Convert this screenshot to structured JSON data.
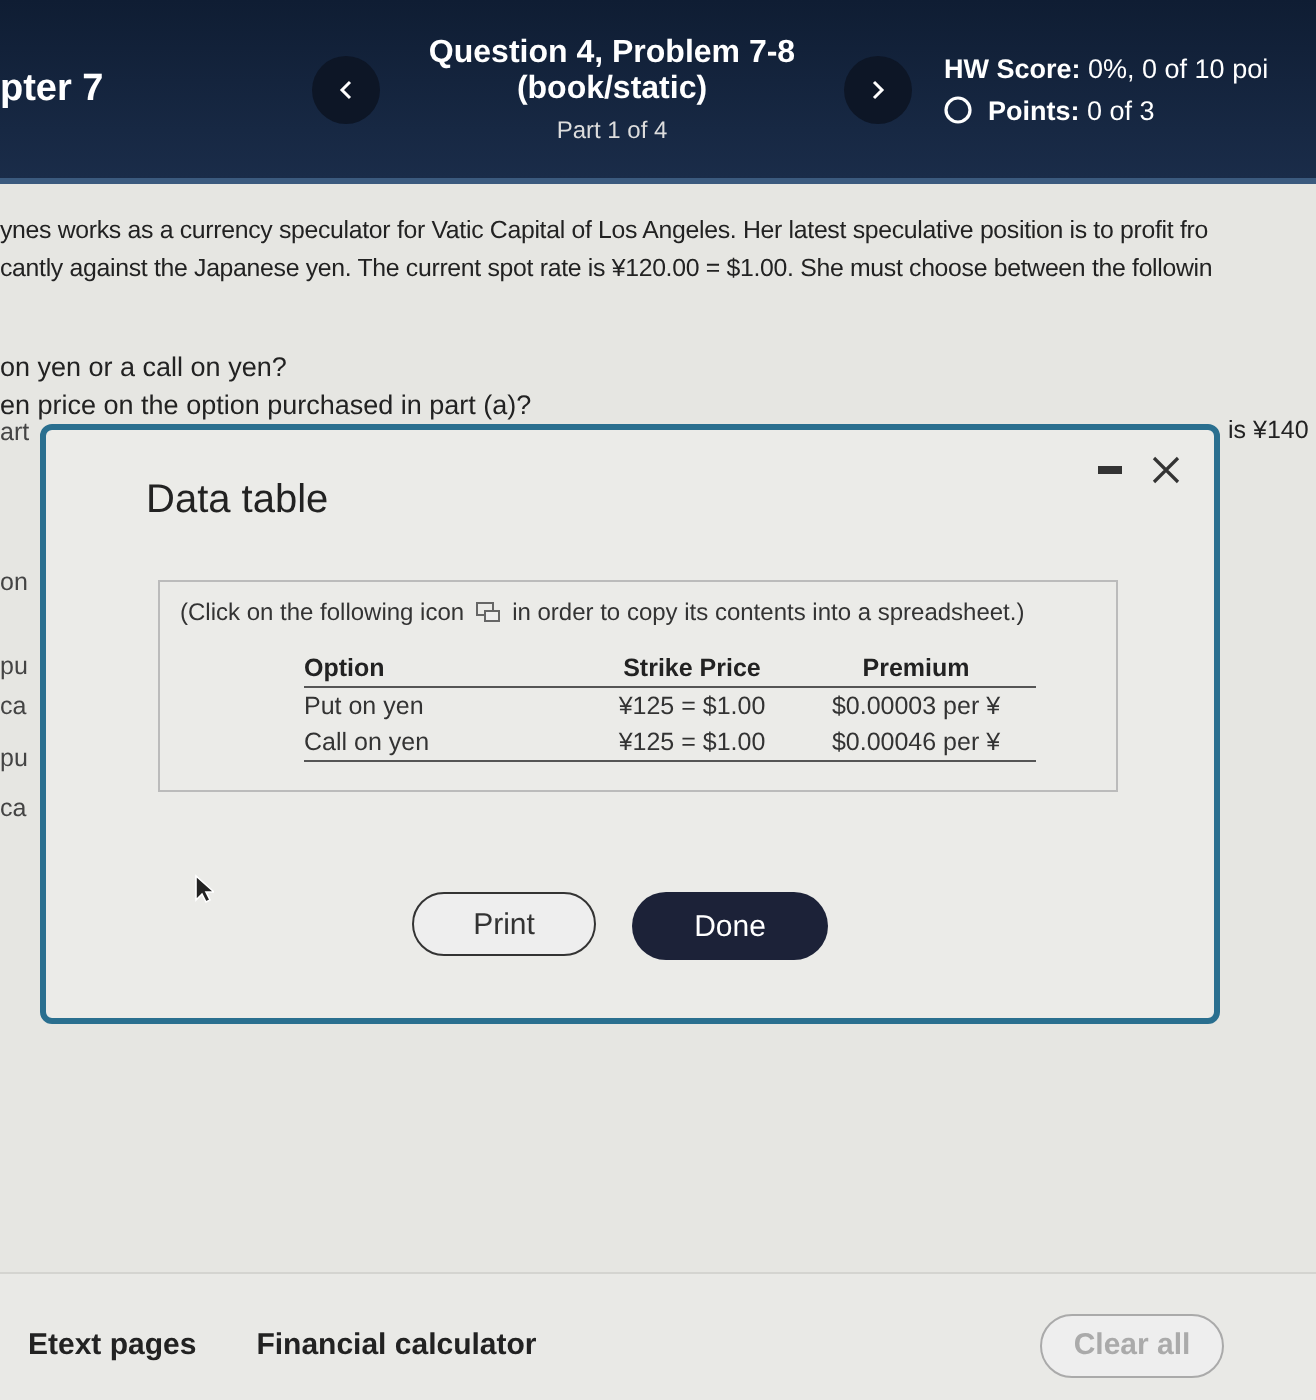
{
  "header": {
    "chapter": "pter 7",
    "title_lines": [
      "Question 4, Problem 7-8",
      "(book/static)"
    ],
    "part": "Part 1 of 4",
    "hw_score": "**HW Score:** 0%, 0 of 10 poi",
    "points": "**Points:** 0 of 3"
  },
  "question": {
    "lines": [
      "ynes works as a currency speculator for Vatic Capital of Los Angeles. Her latest speculative position is to profit fro",
      "cantly against the Japanese yen. The current spot rate is ¥120.00 = $1.00. She must choose between the followin"
    ],
    "parts": [
      "on yen or a call on yen?",
      "en price on the option purchased in part (a)?"
    ],
    "left_fragments": [
      "art",
      "on",
      "pu",
      "ca",
      "pu",
      "ca"
    ],
    "right_fragment": "is ¥140"
  },
  "dialog": {
    "title": "Data table",
    "note_before": "(Click on the following icon",
    "note_after": "in order to copy its contents into a spreadsheet.)",
    "table": {
      "columns": [
        "Option",
        "Strike Price",
        "Premium"
      ],
      "rows": [
        [
          "Put on yen",
          "¥125 = $1.00",
          "$0.00003 per ¥"
        ],
        [
          "Call on yen",
          "¥125 = $1.00",
          "$0.00046 per ¥"
        ]
      ]
    },
    "buttons": [
      {
        "label": "Print",
        "kind": "secondary"
      },
      {
        "label": "Done",
        "kind": "primary"
      }
    ]
  },
  "footer": {
    "links": [
      "Etext pages",
      "Financial calculator"
    ],
    "clear_button": {
      "label": "Clear all",
      "disabled": true
    }
  }
}
